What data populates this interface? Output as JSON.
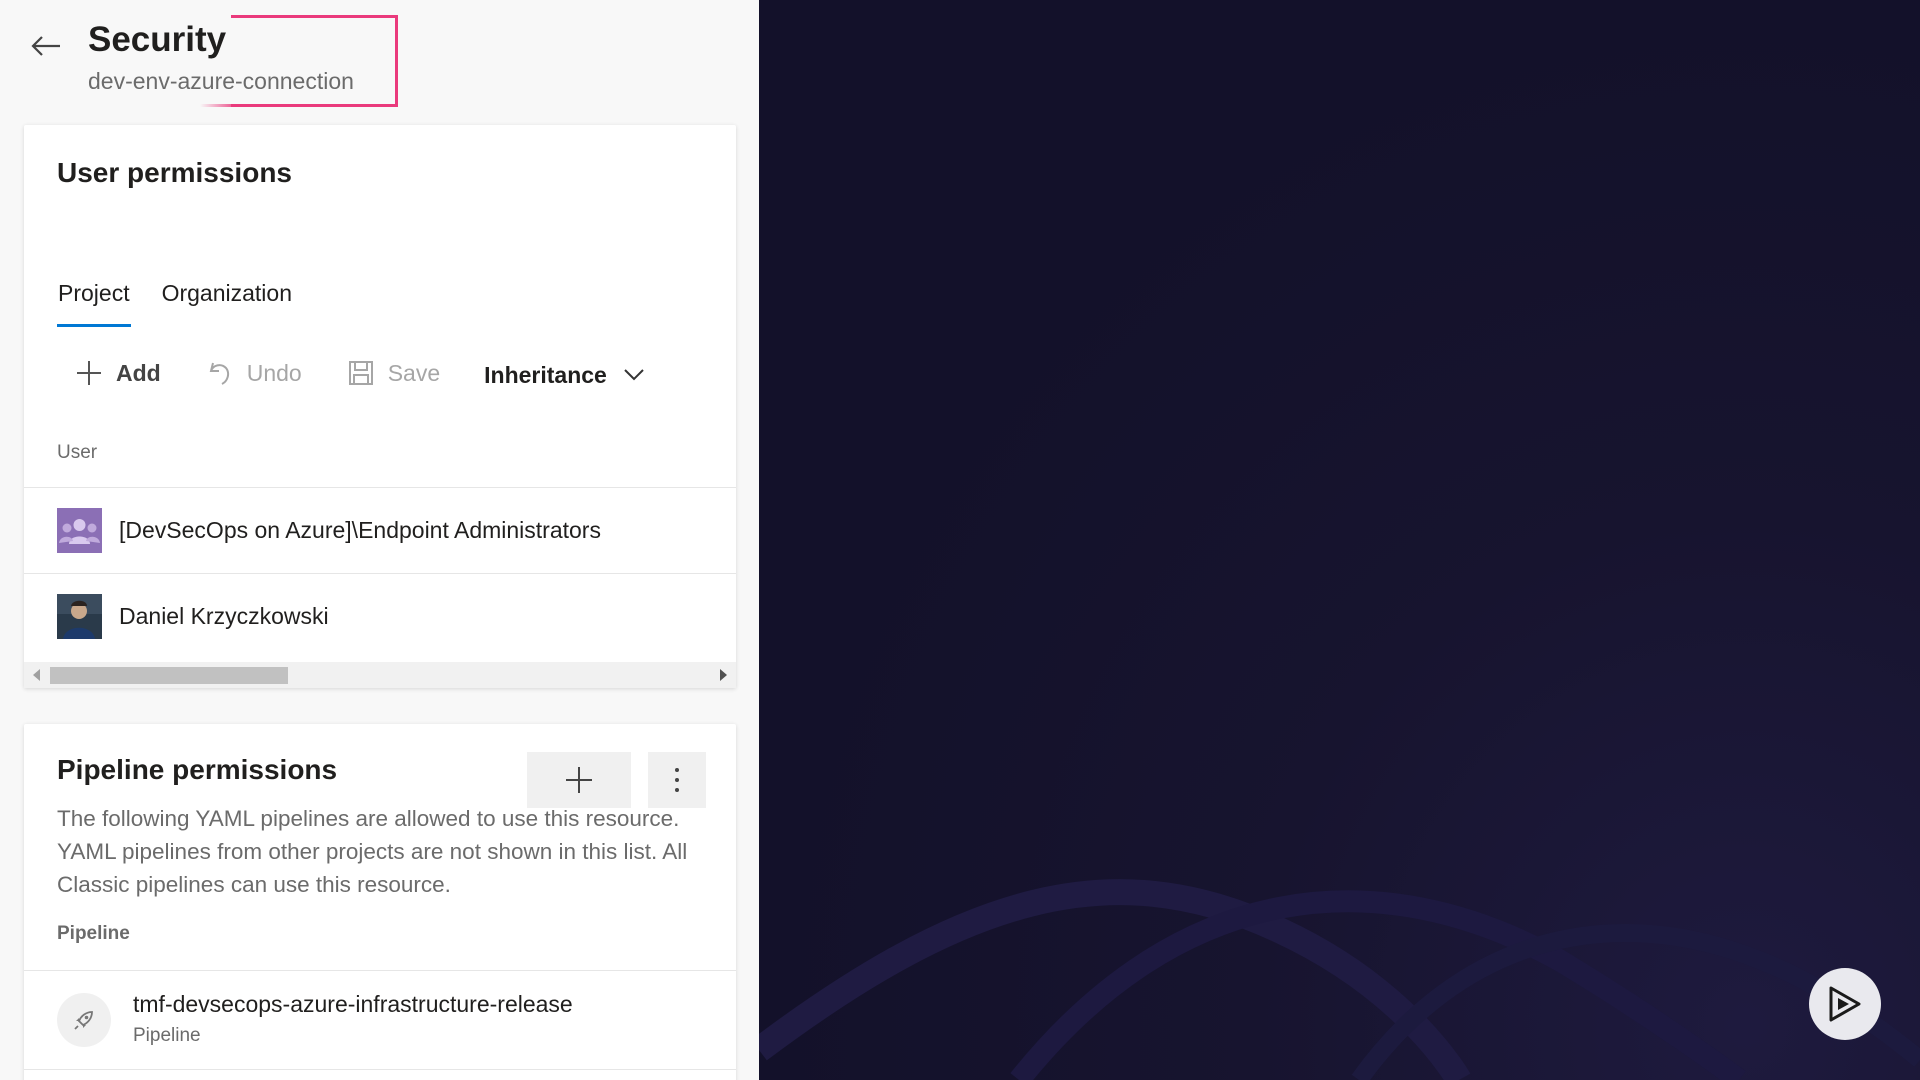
{
  "header": {
    "title": "Security",
    "subtitle": "dev-env-azure-connection",
    "back_icon": "arrow-left-icon",
    "highlight_color": "#ea3a7c"
  },
  "user_permissions": {
    "title": "User permissions",
    "tabs": [
      {
        "label": "Project",
        "active": true
      },
      {
        "label": "Organization",
        "active": false
      }
    ],
    "toolbar": {
      "add_label": "Add",
      "undo_label": "Undo",
      "save_label": "Save",
      "inheritance_label": "Inheritance"
    },
    "column_header": "User",
    "rows": [
      {
        "name": "[DevSecOps on Azure]\\Endpoint Administrators",
        "avatar": "group-avatar-icon"
      },
      {
        "name": "Daniel Krzyczkowski",
        "avatar": "user-photo-avatar"
      }
    ]
  },
  "pipeline_permissions": {
    "title": "Pipeline permissions",
    "description": "The following YAML pipelines are allowed to use this resource. YAML pipelines from other projects are not shown in this list. All Classic pipelines can use this resource.",
    "column_header": "Pipeline",
    "rows": [
      {
        "name": "tmf-devsecops-azure-infrastructure-release",
        "type": "Pipeline",
        "icon": "rocket-icon"
      }
    ]
  },
  "colors": {
    "tab_underline": "#0078d4",
    "right_background": "#14122a",
    "group_avatar": "#8b6fb5"
  }
}
